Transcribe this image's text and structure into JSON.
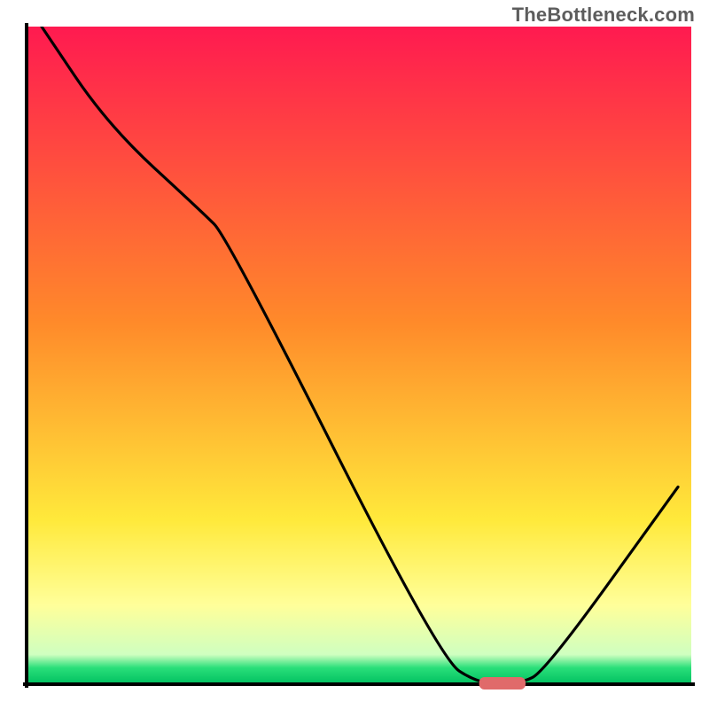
{
  "watermark": "TheBottleneck.com",
  "chart_data": {
    "type": "line",
    "title": "",
    "xlabel": "",
    "ylabel": "",
    "xlim": [
      0,
      100
    ],
    "ylim": [
      0,
      100
    ],
    "grid": false,
    "legend": false,
    "note": "Axes are implied but unlabeled; values are estimated relative percentages read from the curve geometry. y=0 corresponds to the green optimal band at bottom; y=100 is the top (worst).",
    "series": [
      {
        "name": "bottleneck-curve",
        "x": [
          2,
          12,
          26,
          30,
          62,
          68,
          74,
          78,
          98
        ],
        "y": [
          100,
          85,
          72,
          68,
          4,
          0,
          0,
          2,
          30
        ]
      }
    ],
    "annotations": [
      {
        "name": "optimal-marker",
        "shape": "pill",
        "x_range": [
          68,
          75
        ],
        "y": 0,
        "color": "#e06a6a"
      }
    ],
    "background_gradient": {
      "stops": [
        {
          "offset": 0.0,
          "color": "#ff1a50"
        },
        {
          "offset": 0.45,
          "color": "#ff8a2a"
        },
        {
          "offset": 0.75,
          "color": "#ffe93b"
        },
        {
          "offset": 0.88,
          "color": "#ffff9a"
        },
        {
          "offset": 0.955,
          "color": "#cfffc0"
        },
        {
          "offset": 0.975,
          "color": "#2adf7a"
        },
        {
          "offset": 1.0,
          "color": "#00c060"
        }
      ]
    },
    "axis_line_color": "#000000"
  }
}
